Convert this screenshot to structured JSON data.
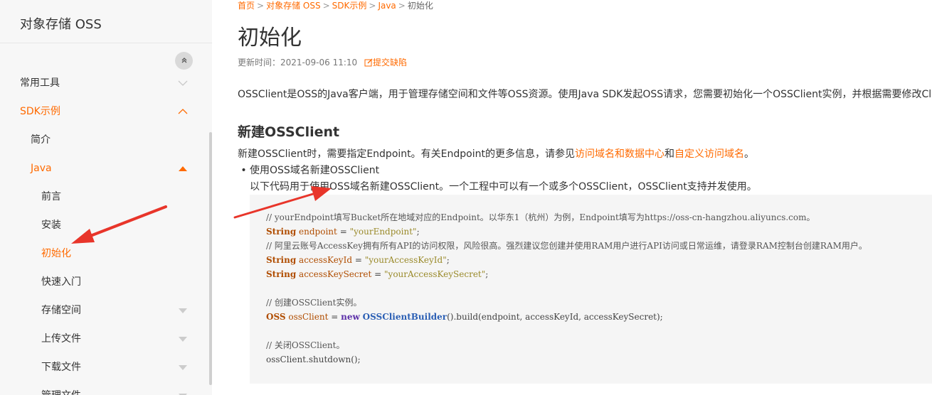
{
  "sidebar": {
    "title": "对象存储 OSS",
    "items": [
      {
        "label": "常用工具",
        "state": "collapsed"
      },
      {
        "label": "SDK示例",
        "state": "expanded"
      },
      {
        "label": "简介"
      },
      {
        "label": "Java",
        "state": "expanded"
      },
      {
        "label": "前言"
      },
      {
        "label": "安装"
      },
      {
        "label": "初始化",
        "state": "active"
      },
      {
        "label": "快速入门"
      },
      {
        "label": "存储空间",
        "state": "collapsed"
      },
      {
        "label": "上传文件",
        "state": "collapsed"
      },
      {
        "label": "下载文件",
        "state": "collapsed"
      },
      {
        "label": "管理文件",
        "state": "collapsed"
      }
    ]
  },
  "breadcrumb": [
    "首页",
    "对象存储 OSS",
    "SDK示例",
    "Java",
    "初始化"
  ],
  "page": {
    "title": "初始化",
    "updated_label": "更新时间：",
    "updated_value": "2021-09-06 11:10",
    "feedback": "提交缺陷",
    "intro": "OSSClient是OSS的Java客户端，用于管理存储空间和文件等OSS资源。使用Java SDK发起OSS请求，您需要初始化一个OSSClient实例，并根据需要修改Cli",
    "section_title": "新建OSSClient",
    "para_pre": "新建OSSClient时，需要指定Endpoint。有关Endpoint的更多信息，请参见",
    "para_link1": "访问域名和数据中心",
    "para_and": "和",
    "para_link2": "自定义访问域名",
    "para_end": "。",
    "bullet": "使用OSS域名新建OSSClient",
    "subpara": "以下代码用于使用OSS域名新建OSSClient。一个工程中可以有一个或多个OSSClient，OSSClient支持并发使用。"
  },
  "code": {
    "c1": "// yourEndpoint填写Bucket所在地域对应的Endpoint。以华东1（杭州）为例，Endpoint填写为https://oss-cn-hangzhou.aliyuncs.com。",
    "c2": "// 阿里云账号AccessKey拥有所有API的访问权限，风险很高。强烈建议您创建并使用RAM用户进行API访问或日常运维，请登录RAM控制台创建RAM用户。",
    "c3": "// 创建OSSClient实例。",
    "c4": "// 关闭OSSClient。",
    "kw_string": "String",
    "kw_oss": "OSS",
    "kw_new": "new",
    "v_endpoint": "endpoint",
    "v_akid": "accessKeyId",
    "v_aksecret": "accessKeySecret",
    "v_client": "ossClient",
    "s_endpoint": "\"yourEndpoint\"",
    "s_akid": "\"yourAccessKeyId\"",
    "s_aksecret": "\"yourAccessKeySecret\"",
    "cls_builder": "OSSClientBuilder",
    "build_call": "().build(endpoint, accessKeyId, accessKeySecret);",
    "shutdown": "ossClient.shutdown();"
  },
  "colors": {
    "accent": "#ff6a00",
    "annotation": "#e8352a"
  },
  "icons": {
    "collapse": "double-chevron-up-icon",
    "chevron": "chevron-icon",
    "caret": "caret-icon",
    "edit": "edit-icon"
  }
}
